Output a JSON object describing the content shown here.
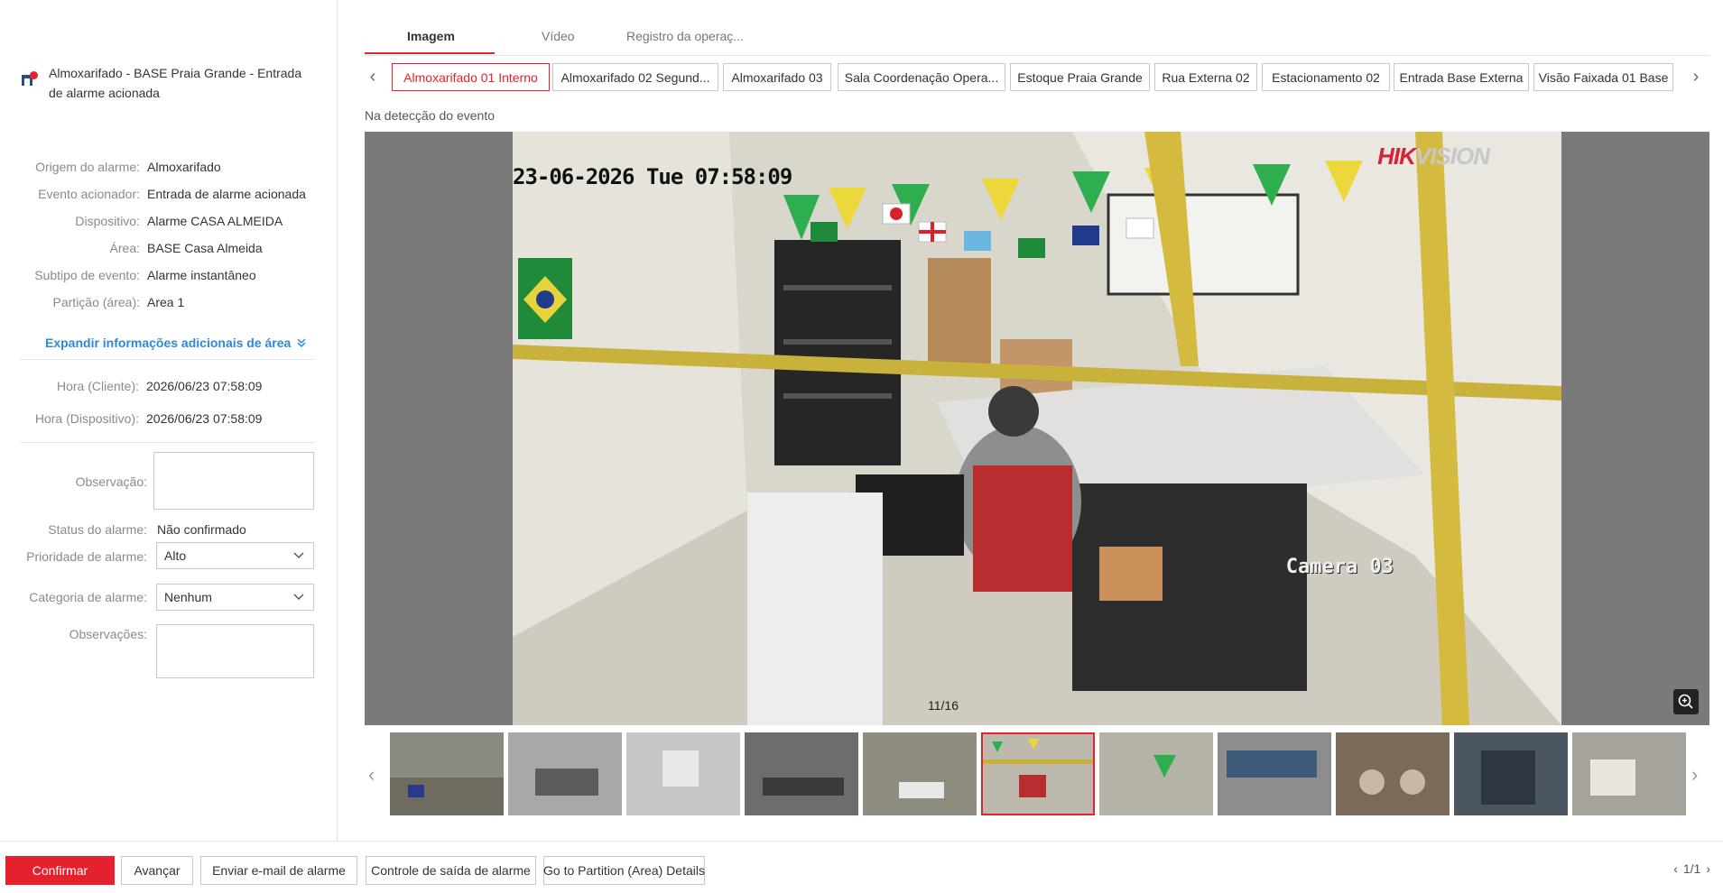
{
  "alarm": {
    "title": "Almoxarifado - BASE Praia Grande - Entrada de alarme acionada"
  },
  "details": [
    {
      "label": "Origem do alarme:",
      "value": "Almoxarifado"
    },
    {
      "label": "Evento acionador:",
      "value": "Entrada de alarme acionada"
    },
    {
      "label": "Dispositivo:",
      "value": "Alarme CASA ALMEIDA"
    },
    {
      "label": "Área:",
      "value": "BASE Casa Almeida"
    },
    {
      "label": "Subtipo de evento:",
      "value": "Alarme instantâneo"
    },
    {
      "label": "Partição (área):",
      "value": "Area 1"
    }
  ],
  "expand_link": "Expandir informações adicionais de área",
  "times": [
    {
      "label": "Hora (Cliente):",
      "value": "2026/06/23 07:58:09"
    },
    {
      "label": "Hora (Dispositivo):",
      "value": "2026/06/23 07:58:09"
    }
  ],
  "form": {
    "observacao_label": "Observação:",
    "status_label": "Status do alarme:",
    "status_value": "Não confirmado",
    "priority_label": "Prioridade de alarme:",
    "priority_value": "Alto",
    "category_label": "Categoria de alarme:",
    "category_value": "Nenhum",
    "observacoes_label": "Observações:"
  },
  "tabs": [
    "Imagem",
    "Vídeo",
    "Registro da operaç..."
  ],
  "cameras": [
    "Almoxarifado 01 Interno",
    "Almoxarifado 02 Segund...",
    "Almoxarifado 03",
    "Sala Coordenação Opera...",
    "Estoque Praia Grande",
    "Rua Externa 02",
    "Estacionamento 02",
    "Entrada Base Externa",
    "Visão Faixada 01 Base"
  ],
  "event_label": "Na detecção do evento",
  "viewer": {
    "osd_time": "23-06-2026 Tue 07:58:09",
    "brand_red": "HIK",
    "brand_grey": "VISION",
    "camera_label": "Camera 03",
    "frame_counter": "11/16"
  },
  "thumbnail_active_index": 5,
  "buttons": {
    "confirm": "Confirmar",
    "next": "Avançar",
    "email": "Enviar e-mail de alarme",
    "output": "Controle de saída de alarme",
    "partition": "Go to Partition (Area) Details"
  },
  "pager": "1/1",
  "colors": {
    "accent": "#e5212d",
    "link": "#2f87d8"
  }
}
